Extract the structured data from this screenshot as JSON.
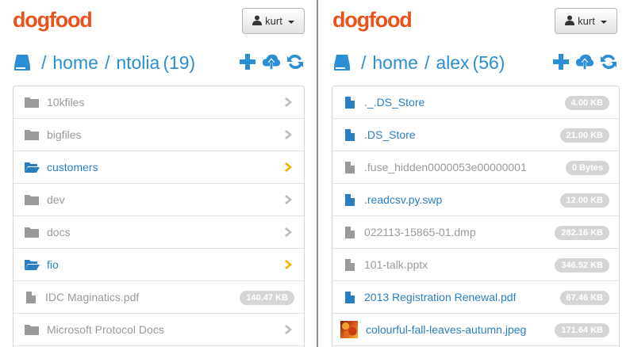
{
  "left": {
    "logo": "dogfood",
    "user": "kurt",
    "breadcrumb": {
      "slash1": "/",
      "home": "home",
      "slash2": "/",
      "folder": "ntolia",
      "count": "(19)"
    },
    "items": [
      {
        "name": "10kfiles",
        "type": "folder",
        "active": false
      },
      {
        "name": "bigfiles",
        "type": "folder",
        "active": false
      },
      {
        "name": "customers",
        "type": "folder",
        "active": true
      },
      {
        "name": "dev",
        "type": "folder",
        "active": false
      },
      {
        "name": "docs",
        "type": "folder",
        "active": false
      },
      {
        "name": "fio",
        "type": "folder",
        "active": true
      },
      {
        "name": "IDC Maginatics.pdf",
        "type": "file",
        "size": "140.47 KB",
        "active": false
      },
      {
        "name": "Microsoft Protocol Docs",
        "type": "folder",
        "active": false
      }
    ]
  },
  "right": {
    "logo": "dogfood",
    "user": "kurt",
    "breadcrumb": {
      "slash1": "/",
      "home": "home",
      "slash2": "/",
      "folder": "alex",
      "count": "(56)"
    },
    "items": [
      {
        "name": "._.DS_Store",
        "type": "file",
        "size": "4.00 KB",
        "active": true
      },
      {
        "name": ".DS_Store",
        "type": "file",
        "size": "21.00 KB",
        "active": true
      },
      {
        "name": ".fuse_hidden0000053e00000001",
        "type": "file",
        "size": "0 Bytes",
        "active": false
      },
      {
        "name": ".readcsv.py.swp",
        "type": "file",
        "size": "12.00 KB",
        "active": true
      },
      {
        "name": "022113-15865-01.dmp",
        "type": "file",
        "size": "282.16 KB",
        "active": false
      },
      {
        "name": "101-talk.pptx",
        "type": "file",
        "size": "346.52 KB",
        "active": false
      },
      {
        "name": "2013 Registration Renewal.pdf",
        "type": "file",
        "size": "67.46 KB",
        "active": true
      },
      {
        "name": "colourful-fall-leaves-autumn.jpeg",
        "type": "image",
        "size": "171.64 KB",
        "active": true
      }
    ]
  },
  "colors": {
    "brand": "#e8531b",
    "accent": "#2a8fd4",
    "active_chevron": "#f0b400",
    "inactive": "#9a9a9a"
  },
  "icons": [
    "hard-drive-icon",
    "plus-icon",
    "upload-cloud-icon",
    "refresh-icon",
    "user-icon",
    "folder-icon",
    "folder-open-icon",
    "file-icon",
    "chevron-right-icon"
  ]
}
